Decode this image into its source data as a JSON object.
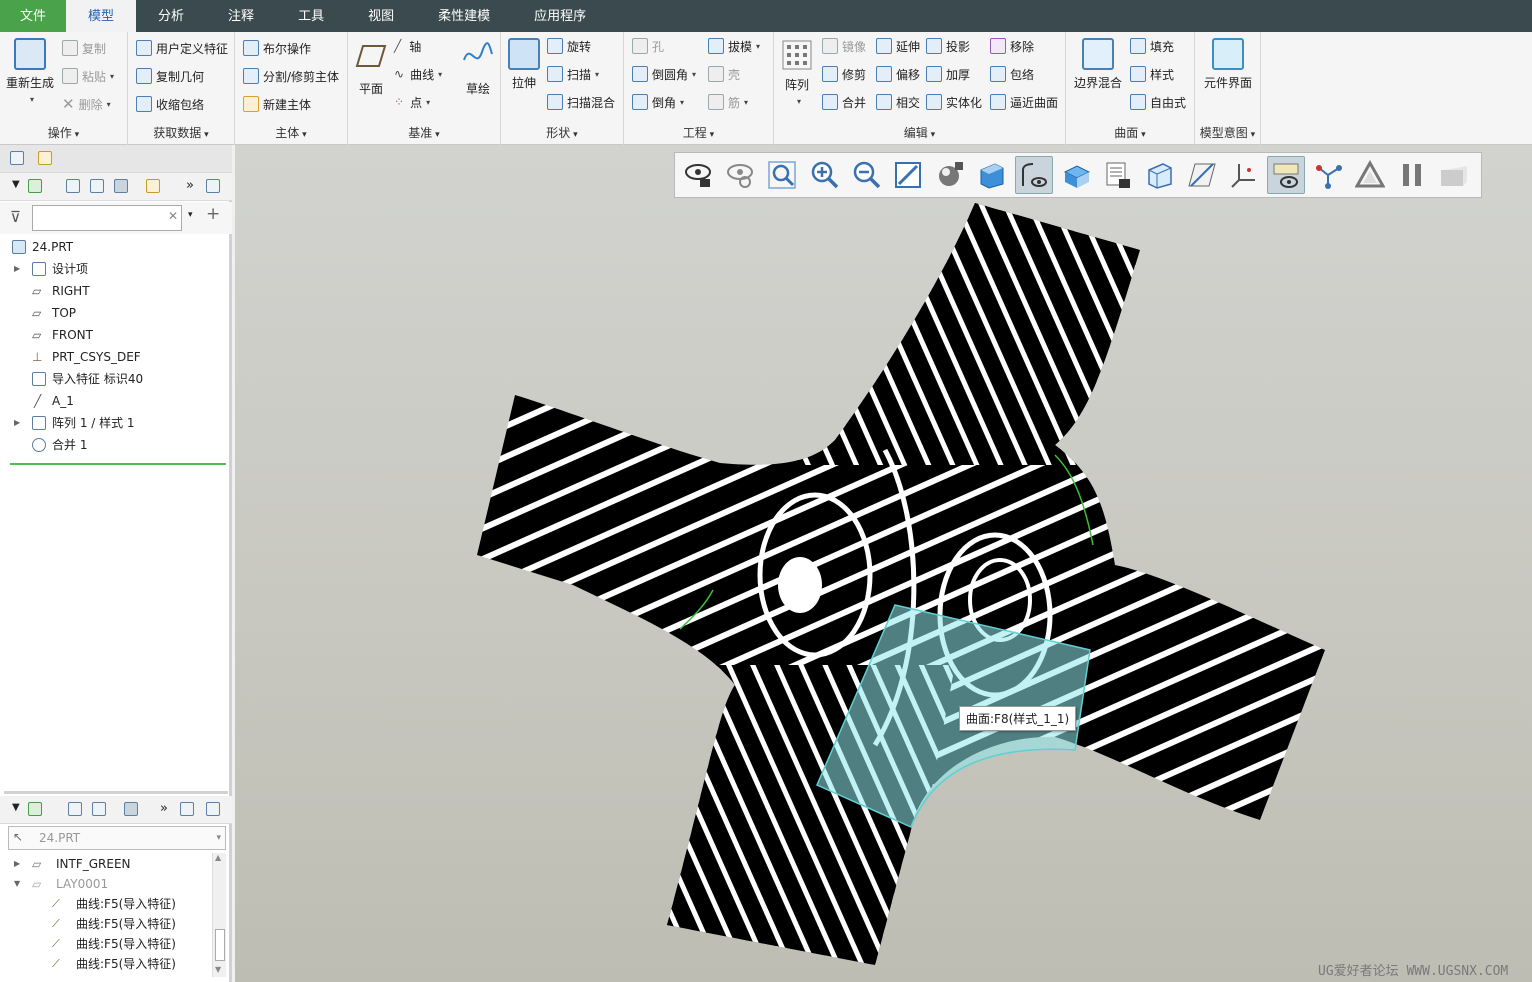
{
  "tabs": [
    {
      "label": "文件"
    },
    {
      "label": "模型"
    },
    {
      "label": "分析"
    },
    {
      "label": "注释"
    },
    {
      "label": "工具"
    },
    {
      "label": "视图"
    },
    {
      "label": "柔性建模"
    },
    {
      "label": "应用程序"
    }
  ],
  "ribbon": {
    "ops": {
      "label": "操作",
      "regen": "重新生成",
      "copy": "复制",
      "paste": "粘贴",
      "delete": "删除"
    },
    "getdata": {
      "label": "获取数据",
      "udf": "用户定义特征",
      "copygeom": "复制几何",
      "shrinkwrap": "收缩包络"
    },
    "body": {
      "label": "主体",
      "boolean": "布尔操作",
      "split": "分割/修剪主体",
      "newbody": "新建主体"
    },
    "datum": {
      "label": "基准",
      "plane": "平面",
      "axis": "轴",
      "curve": "曲线",
      "point": "点",
      "sketch": "草绘"
    },
    "shapes": {
      "label": "形状",
      "extrude": "拉伸",
      "revolve": "旋转",
      "sweep": "扫描",
      "sweptblend": "扫描混合"
    },
    "engineering": {
      "label": "工程",
      "hole": "孔",
      "round": "倒圆角",
      "chamfer": "倒角",
      "draft": "拔模",
      "shell": "壳",
      "rib": "筋"
    },
    "editing": {
      "label": "编辑",
      "pattern": "阵列",
      "mirror": "镜像",
      "trim": "修剪",
      "merge": "合并",
      "extend": "延伸",
      "offset": "偏移",
      "intersect": "相交",
      "project": "投影",
      "thicken": "加厚",
      "solidify": "实体化",
      "remove": "移除",
      "wrap": "包络",
      "approx": "逼近曲面"
    },
    "surfaces": {
      "label": "曲面",
      "boundary": "边界混合",
      "fill": "填充",
      "style": "样式",
      "freestyle": "自由式"
    },
    "intent": {
      "label": "模型意图",
      "component": "元件界面"
    }
  },
  "model_tree": {
    "search_value": "",
    "items": [
      {
        "label": "24.PRT"
      },
      {
        "label": "设计项"
      },
      {
        "label": "RIGHT"
      },
      {
        "label": "TOP"
      },
      {
        "label": "FRONT"
      },
      {
        "label": "PRT_CSYS_DEF"
      },
      {
        "label": "导入特征 标识40"
      },
      {
        "label": "A_1"
      },
      {
        "label": "阵列 1 / 样式 1"
      },
      {
        "label": "合并 1"
      }
    ]
  },
  "layer_tree": {
    "selector": "24.PRT",
    "items": [
      {
        "label": "INTF_GREEN"
      },
      {
        "label": "LAY0001"
      },
      {
        "label": "曲线:F5(导入特征)"
      },
      {
        "label": "曲线:F5(导入特征)"
      },
      {
        "label": "曲线:F5(导入特征)"
      },
      {
        "label": "曲线:F5(导入特征)"
      }
    ]
  },
  "viewport": {
    "tooltip": "曲面:F8(样式_1_1)",
    "watermark": "UG爱好者论坛 WWW.UGSNX.COM",
    "highlight_color": "#8fe8ea",
    "stripe_colors": [
      "#000000",
      "#ffffff"
    ]
  },
  "view_toolbar": [
    "saved-views-icon",
    "refit-icon",
    "zoom-window-icon",
    "zoom-in-icon",
    "zoom-out-icon",
    "repaint-icon",
    "display-style-icon",
    "shaded-icon",
    "perspective-icon",
    "section-icon",
    "manage-views-icon",
    "orientation-icon",
    "plane-display-icon",
    "csys-display-icon",
    "annotation-display-icon",
    "spin-center-icon",
    "appearance-icon",
    "pause-icon",
    "cosmetic-icon"
  ]
}
